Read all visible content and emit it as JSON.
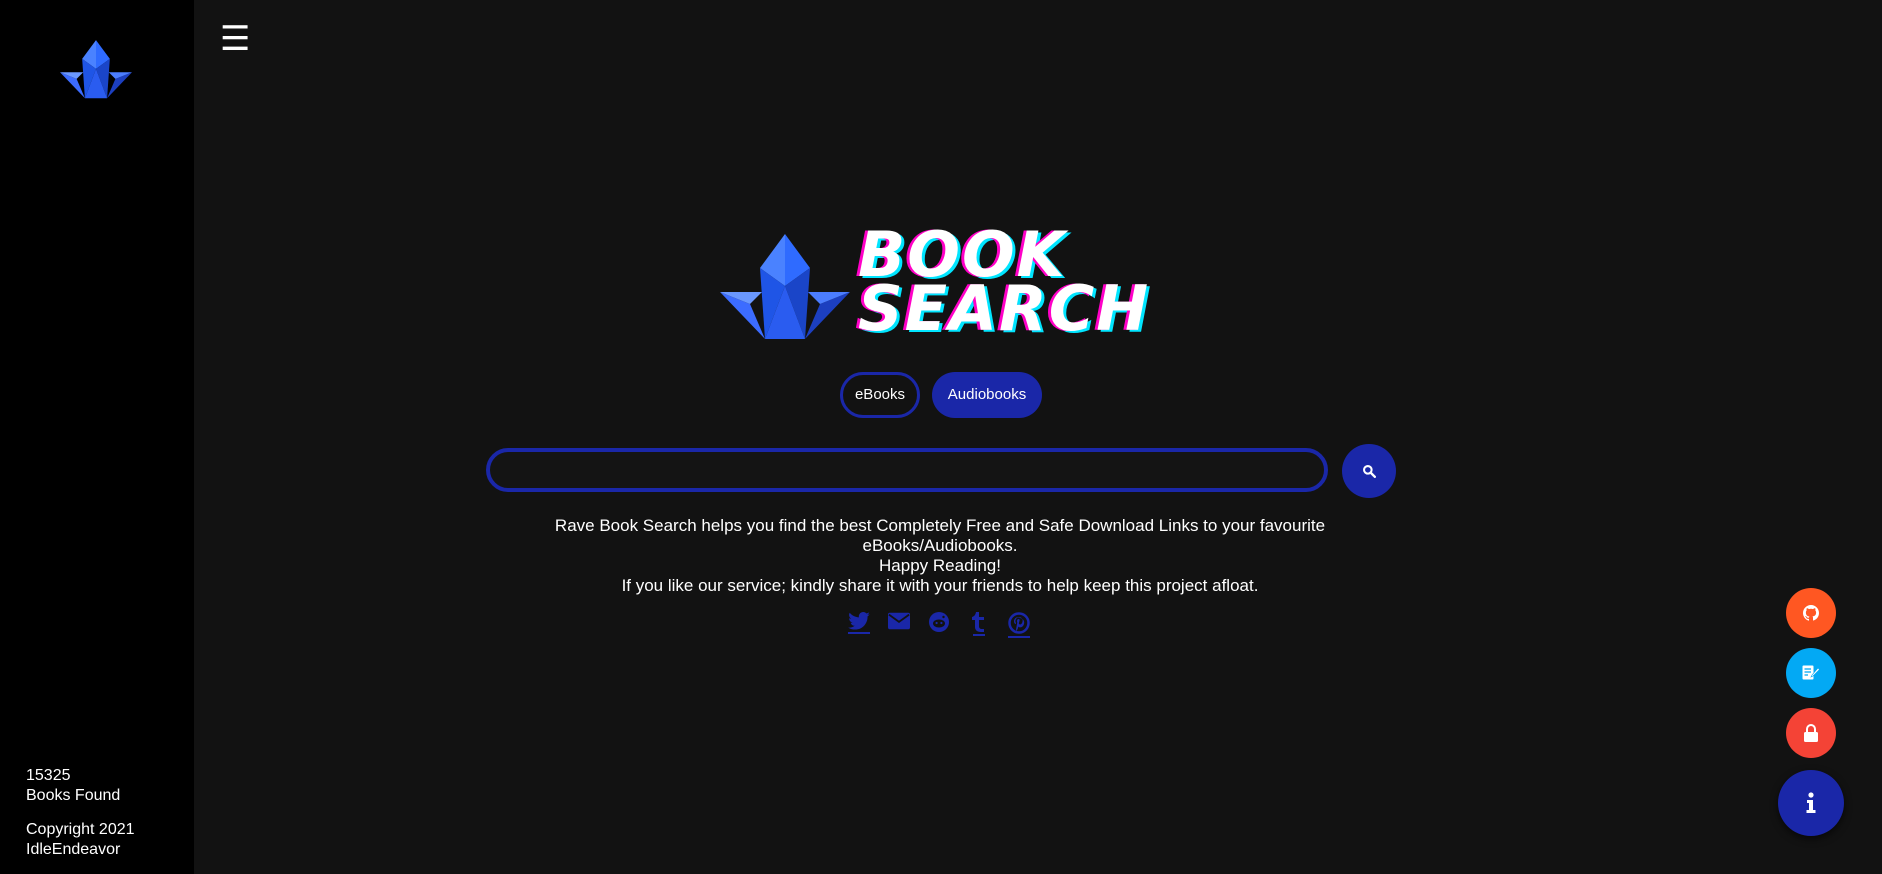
{
  "nav": {
    "menu_glyph": "☰"
  },
  "hero": {
    "title_line1": "BOOK",
    "title_line2": "SEARCH"
  },
  "toggles": {
    "ebooks_label": "eBooks",
    "audiobooks_label": "Audiobooks",
    "selected": "Audiobooks"
  },
  "search": {
    "value": "",
    "placeholder": ""
  },
  "description": {
    "line1": "Rave Book Search helps you find the best Completely Free and Safe Download Links to your favourite eBooks/Audiobooks.",
    "line2": "Happy Reading!",
    "line3": "If you like our service; kindly share it with your friends to help keep this project afloat."
  },
  "share_icons": [
    "twitter-icon",
    "email-icon",
    "reddit-icon",
    "tumblr-icon",
    "pinterest-icon"
  ],
  "sidebar_footer": {
    "books_count": "15325",
    "books_label": "Books Found",
    "copyright": "Copyright 2021",
    "author": "IdleEndeavor"
  },
  "fabs": [
    {
      "icon": "github-icon",
      "color": "#ff5722"
    },
    {
      "icon": "edit-note-icon",
      "color": "#03a9f4"
    },
    {
      "icon": "lock-icon",
      "color": "#f44336"
    },
    {
      "icon": "info-icon",
      "color": "#1a27a8"
    }
  ],
  "colors": {
    "accent": "#1a27a8",
    "sidebar_bg": "#000000",
    "page_bg": "#121212",
    "title_shadow_pink": "#ff00c8",
    "title_shadow_cyan": "#00e5ff"
  }
}
